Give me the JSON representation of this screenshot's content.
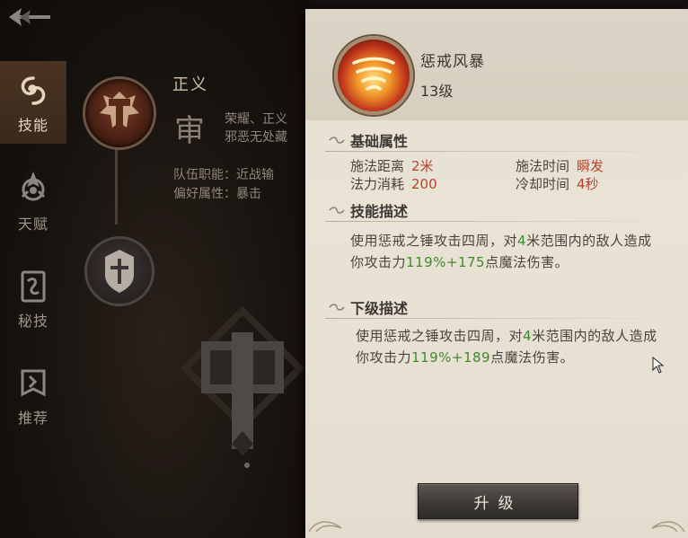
{
  "nav": {
    "items": [
      {
        "label": "技能",
        "icon": "swirl-icon",
        "active": true
      },
      {
        "label": "天赋",
        "icon": "talent-icon",
        "active": false
      },
      {
        "label": "秘技",
        "icon": "book-icon",
        "active": false
      },
      {
        "label": "推荐",
        "icon": "banner-icon",
        "active": false
      }
    ]
  },
  "tree": {
    "title": "正义",
    "glyph": "审",
    "desc_line1": "荣耀、正义",
    "desc_line2": "邪恶无处藏",
    "role_label": "队伍职能：近战输",
    "pref_label": "偏好属性：暴击"
  },
  "panel": {
    "skill_name": "惩戒风暴",
    "skill_level": "13级",
    "basic_title": "基础属性",
    "attrs": {
      "range_label": "施法距离",
      "range_value": "2米",
      "cast_label": "施法时间",
      "cast_value": "瞬发",
      "mana_label": "法力消耗",
      "mana_value": "200",
      "cd_label": "冷却时间",
      "cd_value": "4秒"
    },
    "desc_title": "技能描述",
    "desc": {
      "p1": "使用惩戒之锤攻击四周，对",
      "n1": "4",
      "p2": "米范围内的敌人造成你攻击力",
      "n2": "119%+175",
      "p3": "点魔法伤害。"
    },
    "next_title": "下级描述",
    "next": {
      "p1": "使用惩戒之锤攻击四周，对",
      "n1": "4",
      "p2": "米范围内的敌人造成你攻击力",
      "n2": "119%+189",
      "p3": "点魔法伤害。"
    },
    "upgrade_label": "升级"
  },
  "colors": {
    "value_red": "#b8432c",
    "value_green": "#3f8a2b",
    "panel_bg": "#e7e1d4"
  }
}
